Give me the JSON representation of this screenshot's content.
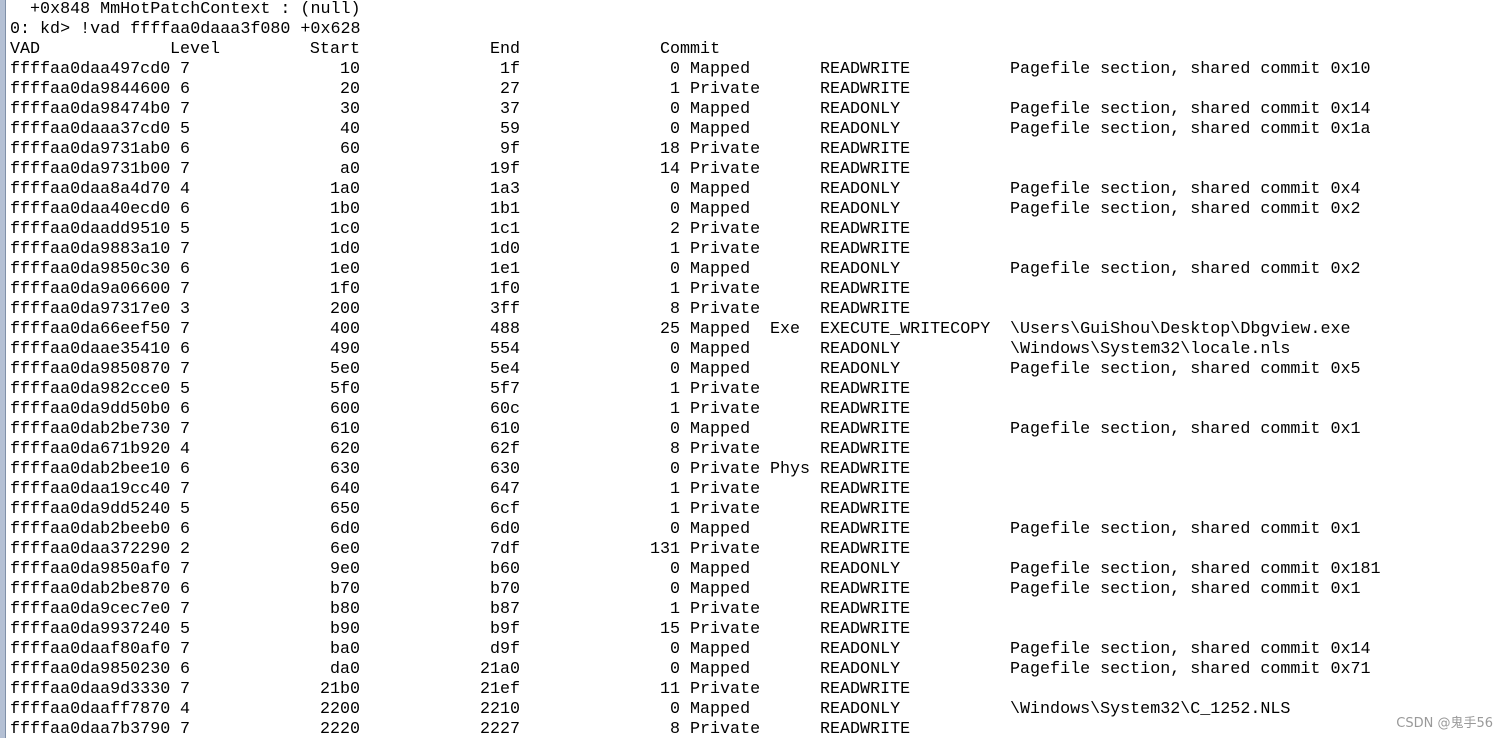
{
  "console": {
    "prev_line": "   +0x848 MmHotPatchContext : (null)",
    "command_line": "0: kd> !vad ffffaa0daaa3f080 +0x628"
  },
  "table": {
    "headers": {
      "vad": "VAD",
      "level": "Level",
      "start": "Start",
      "end": "End",
      "commit": "Commit"
    },
    "rows": [
      [
        "ffffaa0daa497cd0",
        "7",
        "10",
        "1f",
        "0",
        "Mapped",
        "",
        "READWRITE",
        "Pagefile section, shared commit 0x10"
      ],
      [
        "ffffaa0da9844600",
        "6",
        "20",
        "27",
        "1",
        "Private",
        "",
        "READWRITE",
        ""
      ],
      [
        "ffffaa0da98474b0",
        "7",
        "30",
        "37",
        "0",
        "Mapped",
        "",
        "READONLY",
        "Pagefile section, shared commit 0x14"
      ],
      [
        "ffffaa0daaa37cd0",
        "5",
        "40",
        "59",
        "0",
        "Mapped",
        "",
        "READONLY",
        "Pagefile section, shared commit 0x1a"
      ],
      [
        "ffffaa0da9731ab0",
        "6",
        "60",
        "9f",
        "18",
        "Private",
        "",
        "READWRITE",
        ""
      ],
      [
        "ffffaa0da9731b00",
        "7",
        "a0",
        "19f",
        "14",
        "Private",
        "",
        "READWRITE",
        ""
      ],
      [
        "ffffaa0daa8a4d70",
        "4",
        "1a0",
        "1a3",
        "0",
        "Mapped",
        "",
        "READONLY",
        "Pagefile section, shared commit 0x4"
      ],
      [
        "ffffaa0daa40ecd0",
        "6",
        "1b0",
        "1b1",
        "0",
        "Mapped",
        "",
        "READONLY",
        "Pagefile section, shared commit 0x2"
      ],
      [
        "ffffaa0daadd9510",
        "5",
        "1c0",
        "1c1",
        "2",
        "Private",
        "",
        "READWRITE",
        ""
      ],
      [
        "ffffaa0da9883a10",
        "7",
        "1d0",
        "1d0",
        "1",
        "Private",
        "",
        "READWRITE",
        ""
      ],
      [
        "ffffaa0da9850c30",
        "6",
        "1e0",
        "1e1",
        "0",
        "Mapped",
        "",
        "READONLY",
        "Pagefile section, shared commit 0x2"
      ],
      [
        "ffffaa0da9a06600",
        "7",
        "1f0",
        "1f0",
        "1",
        "Private",
        "",
        "READWRITE",
        ""
      ],
      [
        "ffffaa0da97317e0",
        "3",
        "200",
        "3ff",
        "8",
        "Private",
        "",
        "READWRITE",
        ""
      ],
      [
        "ffffaa0da66eef50",
        "7",
        "400",
        "488",
        "25",
        "Mapped",
        "Exe",
        "EXECUTE_WRITECOPY",
        "\\Users\\GuiShou\\Desktop\\Dbgview.exe"
      ],
      [
        "ffffaa0daae35410",
        "6",
        "490",
        "554",
        "0",
        "Mapped",
        "",
        "READONLY",
        "\\Windows\\System32\\locale.nls"
      ],
      [
        "ffffaa0da9850870",
        "7",
        "5e0",
        "5e4",
        "0",
        "Mapped",
        "",
        "READONLY",
        "Pagefile section, shared commit 0x5"
      ],
      [
        "ffffaa0da982cce0",
        "5",
        "5f0",
        "5f7",
        "1",
        "Private",
        "",
        "READWRITE",
        ""
      ],
      [
        "ffffaa0da9dd50b0",
        "6",
        "600",
        "60c",
        "1",
        "Private",
        "",
        "READWRITE",
        ""
      ],
      [
        "ffffaa0dab2be730",
        "7",
        "610",
        "610",
        "0",
        "Mapped",
        "",
        "READWRITE",
        "Pagefile section, shared commit 0x1"
      ],
      [
        "ffffaa0da671b920",
        "4",
        "620",
        "62f",
        "8",
        "Private",
        "",
        "READWRITE",
        ""
      ],
      [
        "ffffaa0dab2bee10",
        "6",
        "630",
        "630",
        "0",
        "Private",
        "Phys",
        "READWRITE",
        ""
      ],
      [
        "ffffaa0daa19cc40",
        "7",
        "640",
        "647",
        "1",
        "Private",
        "",
        "READWRITE",
        ""
      ],
      [
        "ffffaa0da9dd5240",
        "5",
        "650",
        "6cf",
        "1",
        "Private",
        "",
        "READWRITE",
        ""
      ],
      [
        "ffffaa0dab2beeb0",
        "6",
        "6d0",
        "6d0",
        "0",
        "Mapped",
        "",
        "READWRITE",
        "Pagefile section, shared commit 0x1"
      ],
      [
        "ffffaa0daa372290",
        "2",
        "6e0",
        "7df",
        "131",
        "Private",
        "",
        "READWRITE",
        ""
      ],
      [
        "ffffaa0da9850af0",
        "7",
        "9e0",
        "b60",
        "0",
        "Mapped",
        "",
        "READONLY",
        "Pagefile section, shared commit 0x181"
      ],
      [
        "ffffaa0dab2be870",
        "6",
        "b70",
        "b70",
        "0",
        "Mapped",
        "",
        "READWRITE",
        "Pagefile section, shared commit 0x1"
      ],
      [
        "ffffaa0da9cec7e0",
        "7",
        "b80",
        "b87",
        "1",
        "Private",
        "",
        "READWRITE",
        ""
      ],
      [
        "ffffaa0da9937240",
        "5",
        "b90",
        "b9f",
        "15",
        "Private",
        "",
        "READWRITE",
        ""
      ],
      [
        "ffffaa0daaf80af0",
        "7",
        "ba0",
        "d9f",
        "0",
        "Mapped",
        "",
        "READONLY",
        "Pagefile section, shared commit 0x14"
      ],
      [
        "ffffaa0da9850230",
        "6",
        "da0",
        "21a0",
        "0",
        "Mapped",
        "",
        "READONLY",
        "Pagefile section, shared commit 0x71"
      ],
      [
        "ffffaa0daa9d3330",
        "7",
        "21b0",
        "21ef",
        "11",
        "Private",
        "",
        "READWRITE",
        ""
      ],
      [
        "ffffaa0daaff7870",
        "4",
        "2200",
        "2210",
        "0",
        "Mapped",
        "",
        "READONLY",
        "\\Windows\\System32\\C_1252.NLS"
      ],
      [
        "ffffaa0daa7b3790",
        "7",
        "2220",
        "2227",
        "8",
        "Private",
        "",
        "READWRITE",
        ""
      ]
    ]
  },
  "watermark": "CSDN @鬼手56"
}
